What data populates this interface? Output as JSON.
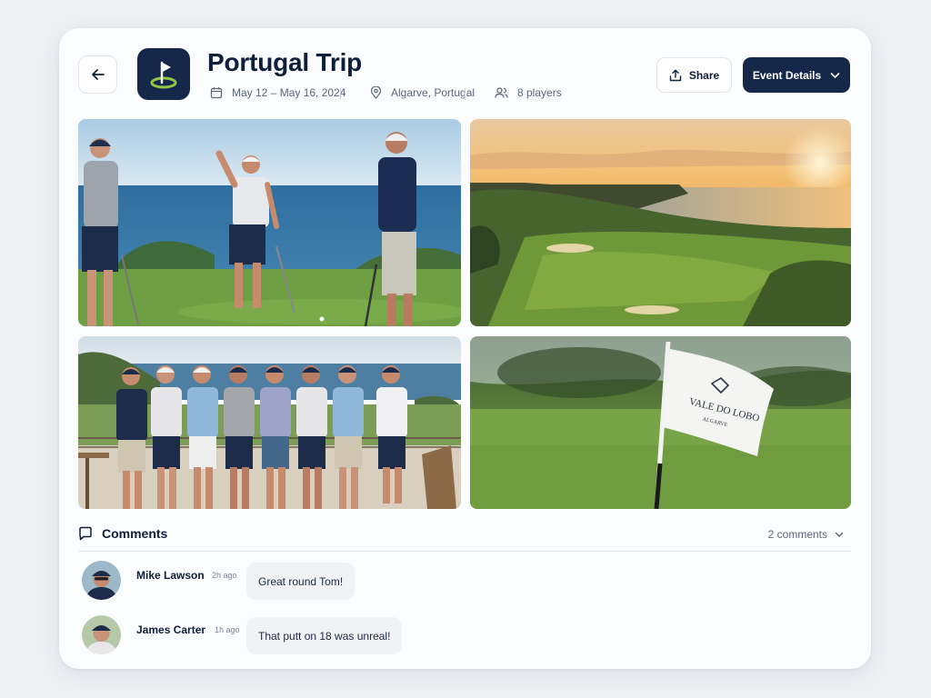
{
  "event": {
    "title": "Portugal Trip",
    "dates": "May 12 – May 16, 2024",
    "location": "Algarve, Portugal",
    "players": "8 players"
  },
  "actions": {
    "share_label": "Share",
    "details_label": "Event Details"
  },
  "photos": [
    {
      "icon": "photo-golfers-celebrating"
    },
    {
      "icon": "photo-coastal-course-sunset"
    },
    {
      "icon": "photo-group-of-eight"
    },
    {
      "icon": "photo-pin-flag"
    }
  ],
  "flag_logo": {
    "line1": "VALE DO LOBO",
    "line2": "ALGARVE"
  },
  "comments": {
    "title": "Comments",
    "count_label": "2 comments",
    "items": [
      {
        "author": "Mike Lawson",
        "time": "2h ago",
        "text": "Great round Tom!"
      },
      {
        "author": "James Carter",
        "time": "1h ago",
        "text": "That putt on 18 was unreal!"
      }
    ]
  },
  "colors": {
    "brand_navy": "#16284a",
    "accent_green": "#8fc742",
    "background": "#eef0f4",
    "card": "#fbfcfd"
  }
}
